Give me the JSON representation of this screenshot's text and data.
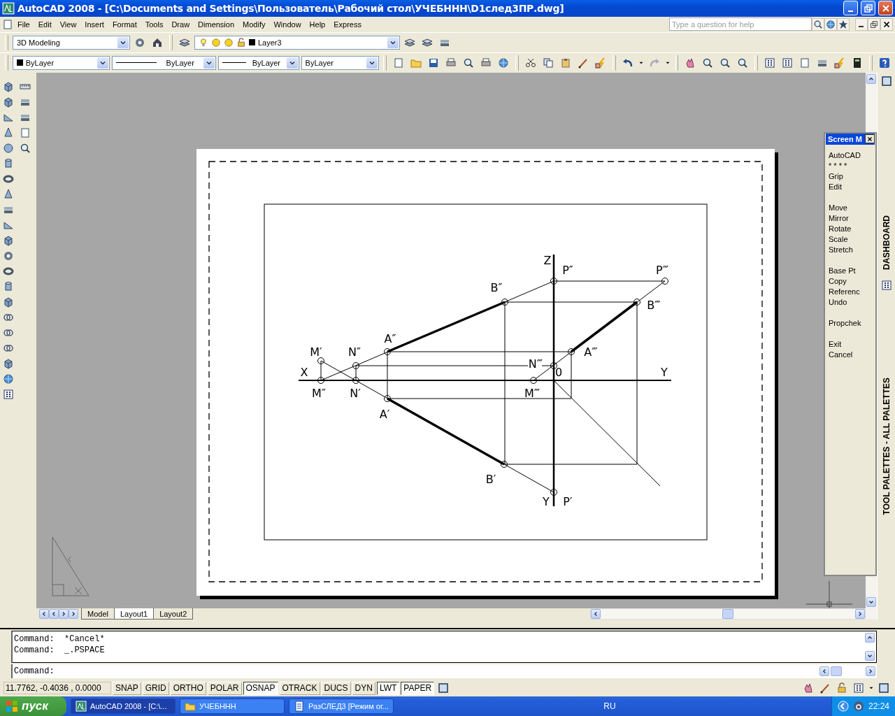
{
  "window": {
    "title": "AutoCAD 2008 - [C:\\Documents and Settings\\Пользователь\\Рабочий стол\\УЧЕБННН\\D1след3ПР.dwg]"
  },
  "menu": [
    "File",
    "Edit",
    "View",
    "Insert",
    "Format",
    "Tools",
    "Draw",
    "Dimension",
    "Modify",
    "Window",
    "Help",
    "Express"
  ],
  "help_search": {
    "placeholder": "Type a question for help"
  },
  "workspace": {
    "value": "3D Modeling"
  },
  "layer": {
    "value": "Layer3"
  },
  "properties": [
    {
      "kind": "color",
      "value": "ByLayer"
    },
    {
      "kind": "linetype",
      "value": "ByLayer"
    },
    {
      "kind": "lineweight",
      "value": "ByLayer"
    },
    {
      "kind": "plotstyle",
      "value": "ByLayer"
    }
  ],
  "drawing": {
    "labels": [
      "Z",
      "P″",
      "P‴",
      "B″",
      "B‴",
      "A″",
      "M′",
      "N″",
      "A‴",
      "N‴",
      "X",
      "0",
      "Y",
      "M″",
      "N′",
      "M‴",
      "A′",
      "B′",
      "Y",
      "P′"
    ]
  },
  "screen_menu": {
    "title": "Screen M",
    "groups": [
      [
        "AutoCAD",
        "* * * *",
        "Grip",
        "Edit"
      ],
      [
        "Move",
        "Mirror",
        "Rotate",
        "Scale",
        "Stretch"
      ],
      [
        "Base Pt",
        "Copy",
        "Referenc",
        "Undo"
      ],
      [
        "Propchek"
      ],
      [
        "Exit",
        "Cancel"
      ]
    ]
  },
  "side_palettes": [
    "DASHBOARD",
    "TOOL PALETTES - ALL PALETTES"
  ],
  "layout_tabs": [
    {
      "label": "Model",
      "selected": false
    },
    {
      "label": "Layout1",
      "selected": true
    },
    {
      "label": "Layout2",
      "selected": false
    }
  ],
  "command_window": {
    "lines": [
      "Command:  *Cancel*",
      "Command:  _.PSPACE"
    ],
    "prompt": "Command:"
  },
  "status_bar": {
    "coordinates": "11.7762,  -0.4036 , 0.0000",
    "toggles": [
      {
        "label": "SNAP",
        "on": false
      },
      {
        "label": "GRID",
        "on": false
      },
      {
        "label": "ORTHO",
        "on": false
      },
      {
        "label": "POLAR",
        "on": false
      },
      {
        "label": "OSNAP",
        "on": true
      },
      {
        "label": "OTRACK",
        "on": false
      },
      {
        "label": "DUCS",
        "on": false
      },
      {
        "label": "DYN",
        "on": false
      },
      {
        "label": "LWT",
        "on": true
      },
      {
        "label": "PAPER",
        "on": true
      }
    ]
  },
  "taskbar": {
    "start": "пуск",
    "tasks": [
      {
        "kind": "app",
        "label": "AutoCAD 2008 - [C:\\...",
        "selected": true
      },
      {
        "kind": "folder",
        "label": "УЧЕБННН",
        "selected": false
      },
      {
        "kind": "document",
        "label": "РазСЛЕД3 [Режим ог...",
        "selected": false
      }
    ],
    "language": "RU",
    "clock": "22:24"
  }
}
